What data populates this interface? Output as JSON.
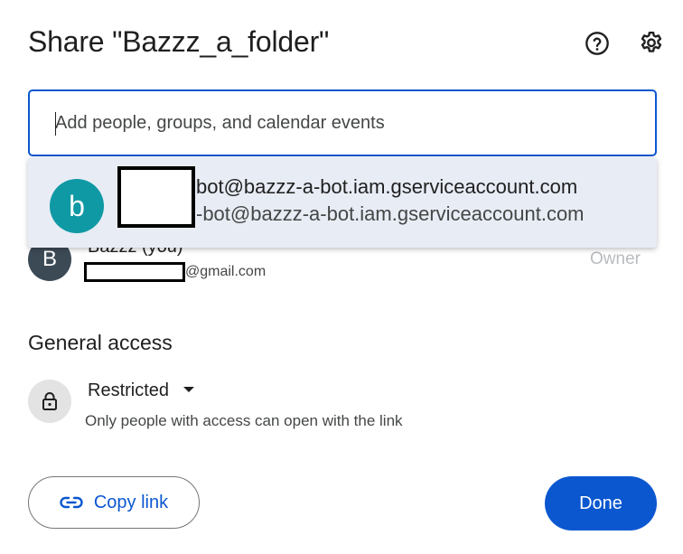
{
  "dialog": {
    "title": "Share \"Bazzz_a_folder\"",
    "help_icon": "help-circle-icon",
    "settings_icon": "gear-icon"
  },
  "search": {
    "placeholder": "Add people, groups, and calendar events",
    "value": ""
  },
  "suggestion": {
    "avatar_letter": "b",
    "avatar_color": "#0f99a5",
    "email_line1": "bot@bazzz-a-bot.iam.gserviceaccount.com",
    "email_line2": "-bot@bazzz-a-bot.iam.gserviceaccount.com"
  },
  "people": [
    {
      "avatar_letter": "B",
      "avatar_color": "#3c4a56",
      "name": "Bazzz (you)",
      "email_suffix": "@gmail.com",
      "role": "Owner"
    }
  ],
  "general_access": {
    "heading": "General access",
    "icon": "lock-icon",
    "selected": "Restricted",
    "description": "Only people with access can open with the link"
  },
  "footer": {
    "copy_link_label": "Copy link",
    "copy_link_icon": "link-icon",
    "done_label": "Done"
  },
  "colors": {
    "accent": "#0b57d0",
    "dropdown_bg": "#e8ecf5"
  }
}
